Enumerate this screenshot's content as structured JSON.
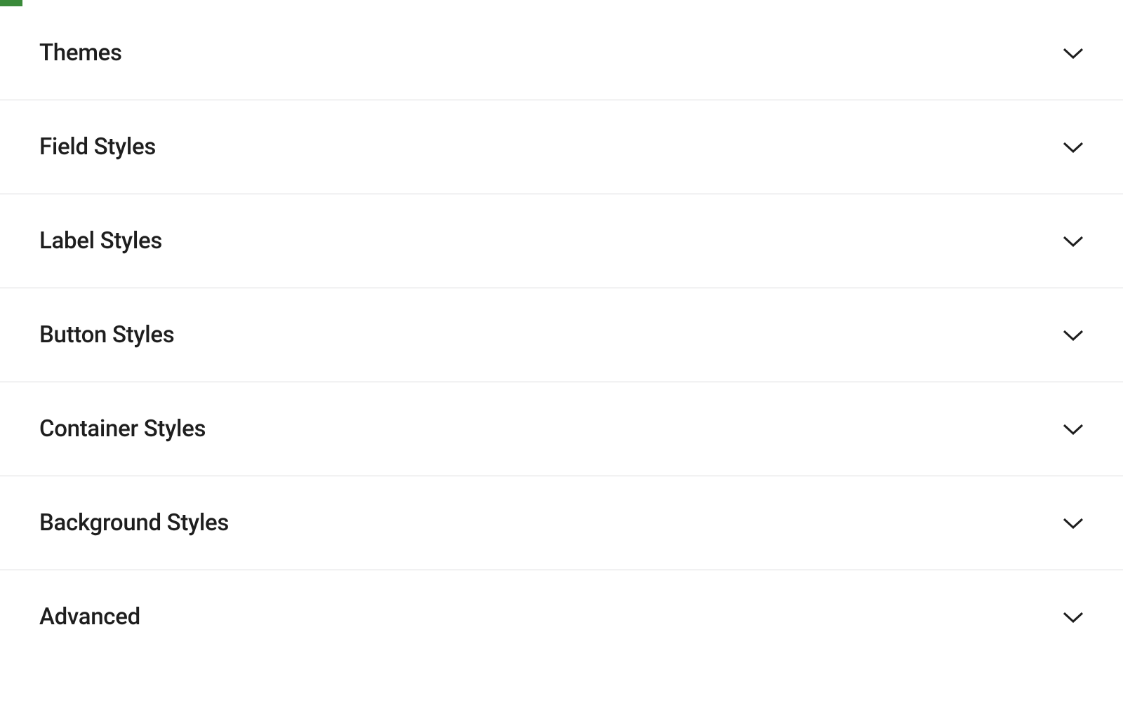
{
  "accordion": {
    "sections": [
      {
        "id": "themes",
        "label": "Themes"
      },
      {
        "id": "field-styles",
        "label": "Field Styles"
      },
      {
        "id": "label-styles",
        "label": "Label Styles"
      },
      {
        "id": "button-styles",
        "label": "Button Styles"
      },
      {
        "id": "container-styles",
        "label": "Container Styles"
      },
      {
        "id": "background-styles",
        "label": "Background Styles"
      },
      {
        "id": "advanced",
        "label": "Advanced"
      }
    ]
  }
}
